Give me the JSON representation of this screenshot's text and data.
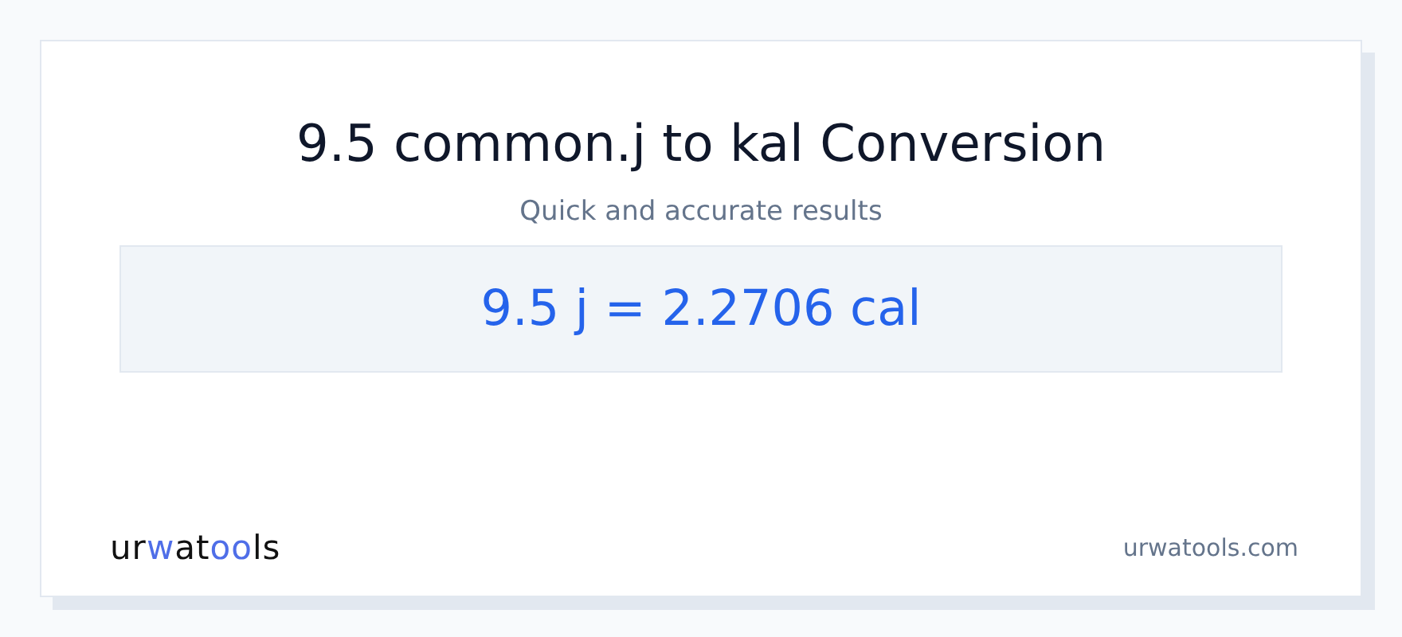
{
  "title": "9.5 common.j to kal Conversion",
  "subtitle": "Quick and accurate results",
  "result": "9.5 j = 2.2706 cal",
  "logo": [
    {
      "text": "ur",
      "accent": false
    },
    {
      "text": "w",
      "accent": true
    },
    {
      "text": "at",
      "accent": false
    },
    {
      "text": "oo",
      "accent": true
    },
    {
      "text": "ls",
      "accent": false
    }
  ],
  "site": "urwatools.com"
}
